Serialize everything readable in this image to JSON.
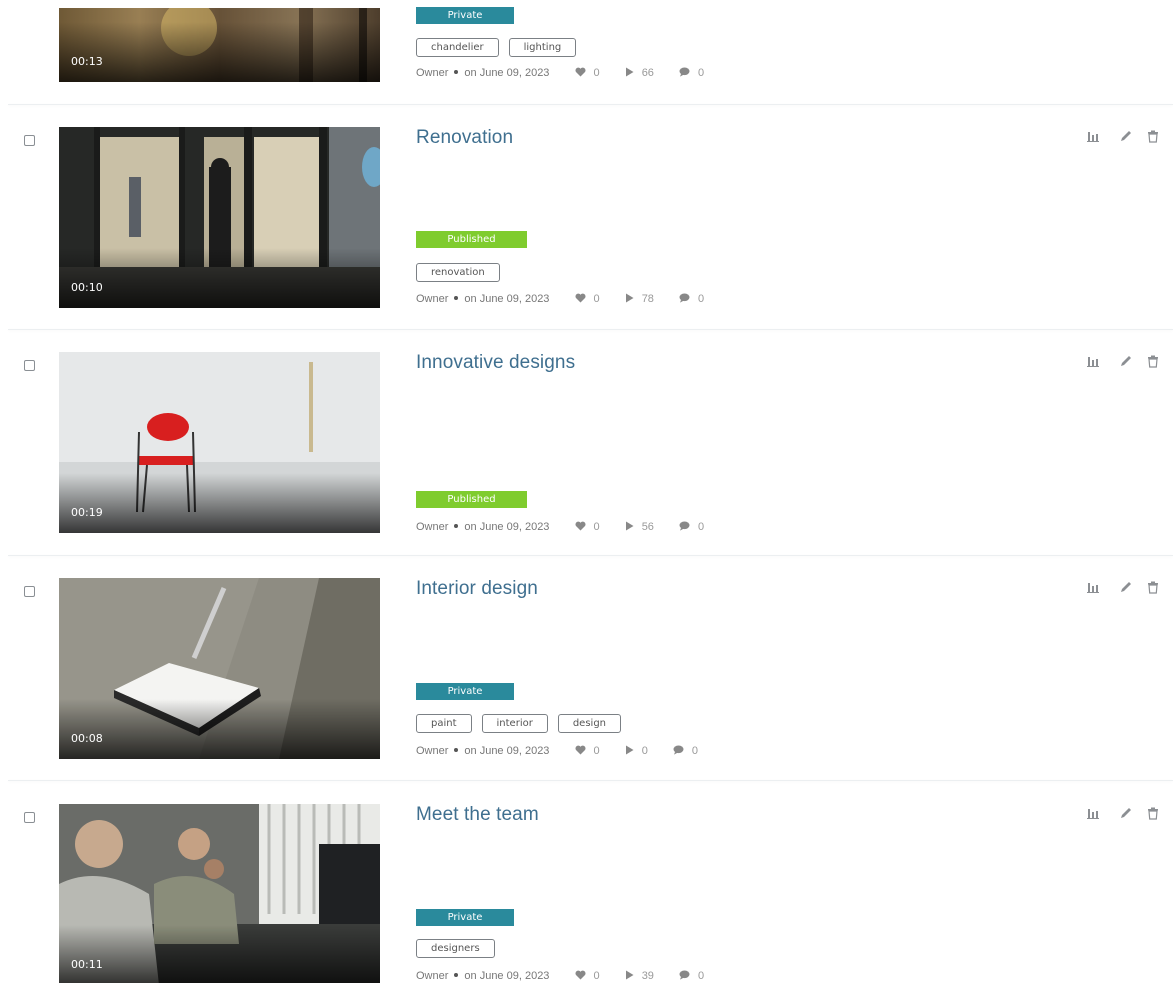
{
  "videos": [
    {
      "title": "",
      "duration": "00:13",
      "status": "Private",
      "tags": [
        "chandelier",
        "lighting"
      ],
      "owner": "Owner",
      "date": "on June 09, 2023",
      "likes": "0",
      "plays": "66",
      "comments": "0"
    },
    {
      "title": "Renovation",
      "duration": "00:10",
      "status": "Published",
      "tags": [
        "renovation"
      ],
      "owner": "Owner",
      "date": "on June 09, 2023",
      "likes": "0",
      "plays": "78",
      "comments": "0"
    },
    {
      "title": "Innovative designs",
      "duration": "00:19",
      "status": "Published",
      "tags": [],
      "owner": "Owner",
      "date": "on June 09, 2023",
      "likes": "0",
      "plays": "56",
      "comments": "0"
    },
    {
      "title": "Interior design",
      "duration": "00:08",
      "status": "Private",
      "tags": [
        "paint",
        "interior",
        "design"
      ],
      "owner": "Owner",
      "date": "on June 09, 2023",
      "likes": "0",
      "plays": "0",
      "comments": "0"
    },
    {
      "title": "Meet the team",
      "duration": "00:11",
      "status": "Private",
      "tags": [
        "designers"
      ],
      "owner": "Owner",
      "date": "on June 09, 2023",
      "likes": "0",
      "plays": "39",
      "comments": "0"
    }
  ],
  "icons": {
    "stats": "bar-chart-icon",
    "edit": "pencil-icon",
    "delete": "trash-icon",
    "likes": "heart-icon",
    "plays": "play-icon",
    "comments": "comment-icon"
  },
  "colors": {
    "title": "#3f6f8f",
    "private": "#2a8a9c",
    "published": "#7fcc2e"
  }
}
